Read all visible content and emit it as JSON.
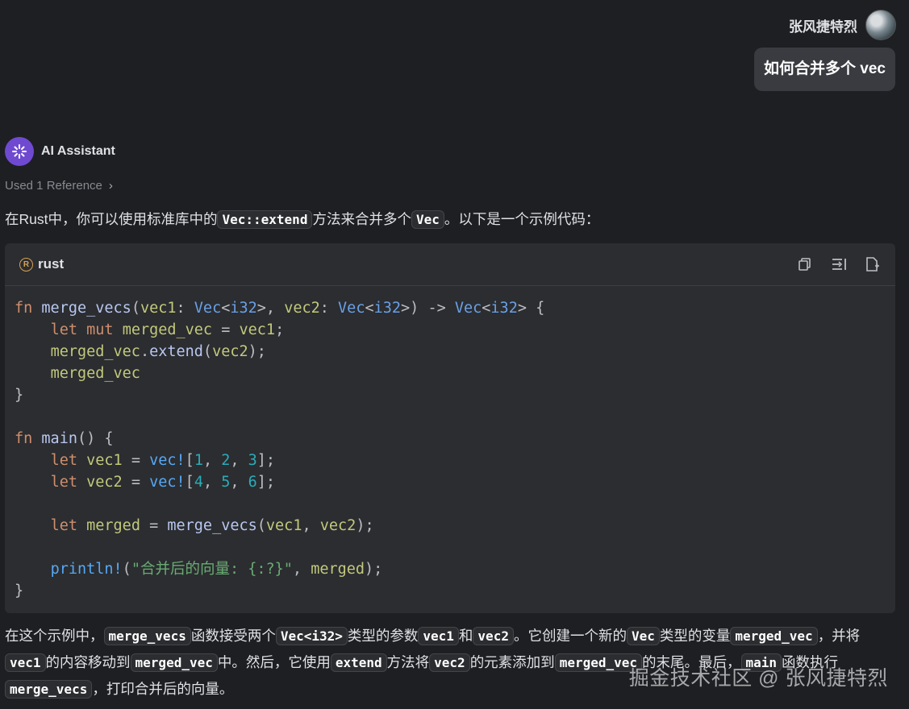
{
  "user": {
    "name": "张风捷特烈",
    "message": "如何合并多个 vec"
  },
  "assistant": {
    "name": "AI Assistant",
    "reference_label": "Used 1 Reference"
  },
  "intro": {
    "t1": "在Rust中，你可以使用标准库中的",
    "c1": "Vec::extend",
    "t2": "方法来合并多个",
    "c2": "Vec",
    "t3": "。以下是一个示例代码："
  },
  "code_block": {
    "language": "rust",
    "icons": [
      "copy-icon",
      "insert-icon",
      "new-file-icon"
    ],
    "lines": [
      "fn merge_vecs(vec1: Vec<i32>, vec2: Vec<i32>) -> Vec<i32> {",
      "    let mut merged_vec = vec1;",
      "    merged_vec.extend(vec2);",
      "    merged_vec",
      "}",
      "",
      "fn main() {",
      "    let vec1 = vec![1, 2, 3];",
      "    let vec2 = vec![4, 5, 6];",
      "",
      "    let merged = merge_vecs(vec1, vec2);",
      "",
      "    println!(\"合并后的向量: {:?}\", merged);",
      "}"
    ]
  },
  "explain": {
    "t1": "在这个示例中，",
    "c1": "merge_vecs",
    "t2": "函数接受两个",
    "c2": "Vec<i32>",
    "t3": "类型的参数",
    "c3": "vec1",
    "t4": "和",
    "c4": "vec2",
    "t5": "。它创建一个新的",
    "c5": "Vec",
    "t6": "类型的变量",
    "c6": "merged_vec",
    "t7": "，并将",
    "c7": "vec1",
    "t8": "的内容移动到",
    "c8": "merged_vec",
    "t9": "中。然后，它使用",
    "c9": "extend",
    "t10": "方法将",
    "c10": "vec2",
    "t11": "的元素添加到",
    "c11": "merged_vec",
    "t12": "的末尾。最后，",
    "c12": "main",
    "t13": "函数执行",
    "c13": "merge_vecs",
    "t14": "，打印合并后的向量。"
  },
  "watermark": "掘金技术社区 @ 张风捷特烈",
  "colors": {
    "background": "#1e1f22",
    "code_bg": "#2b2d30",
    "assistant_avatar": "#6f4ad0"
  }
}
